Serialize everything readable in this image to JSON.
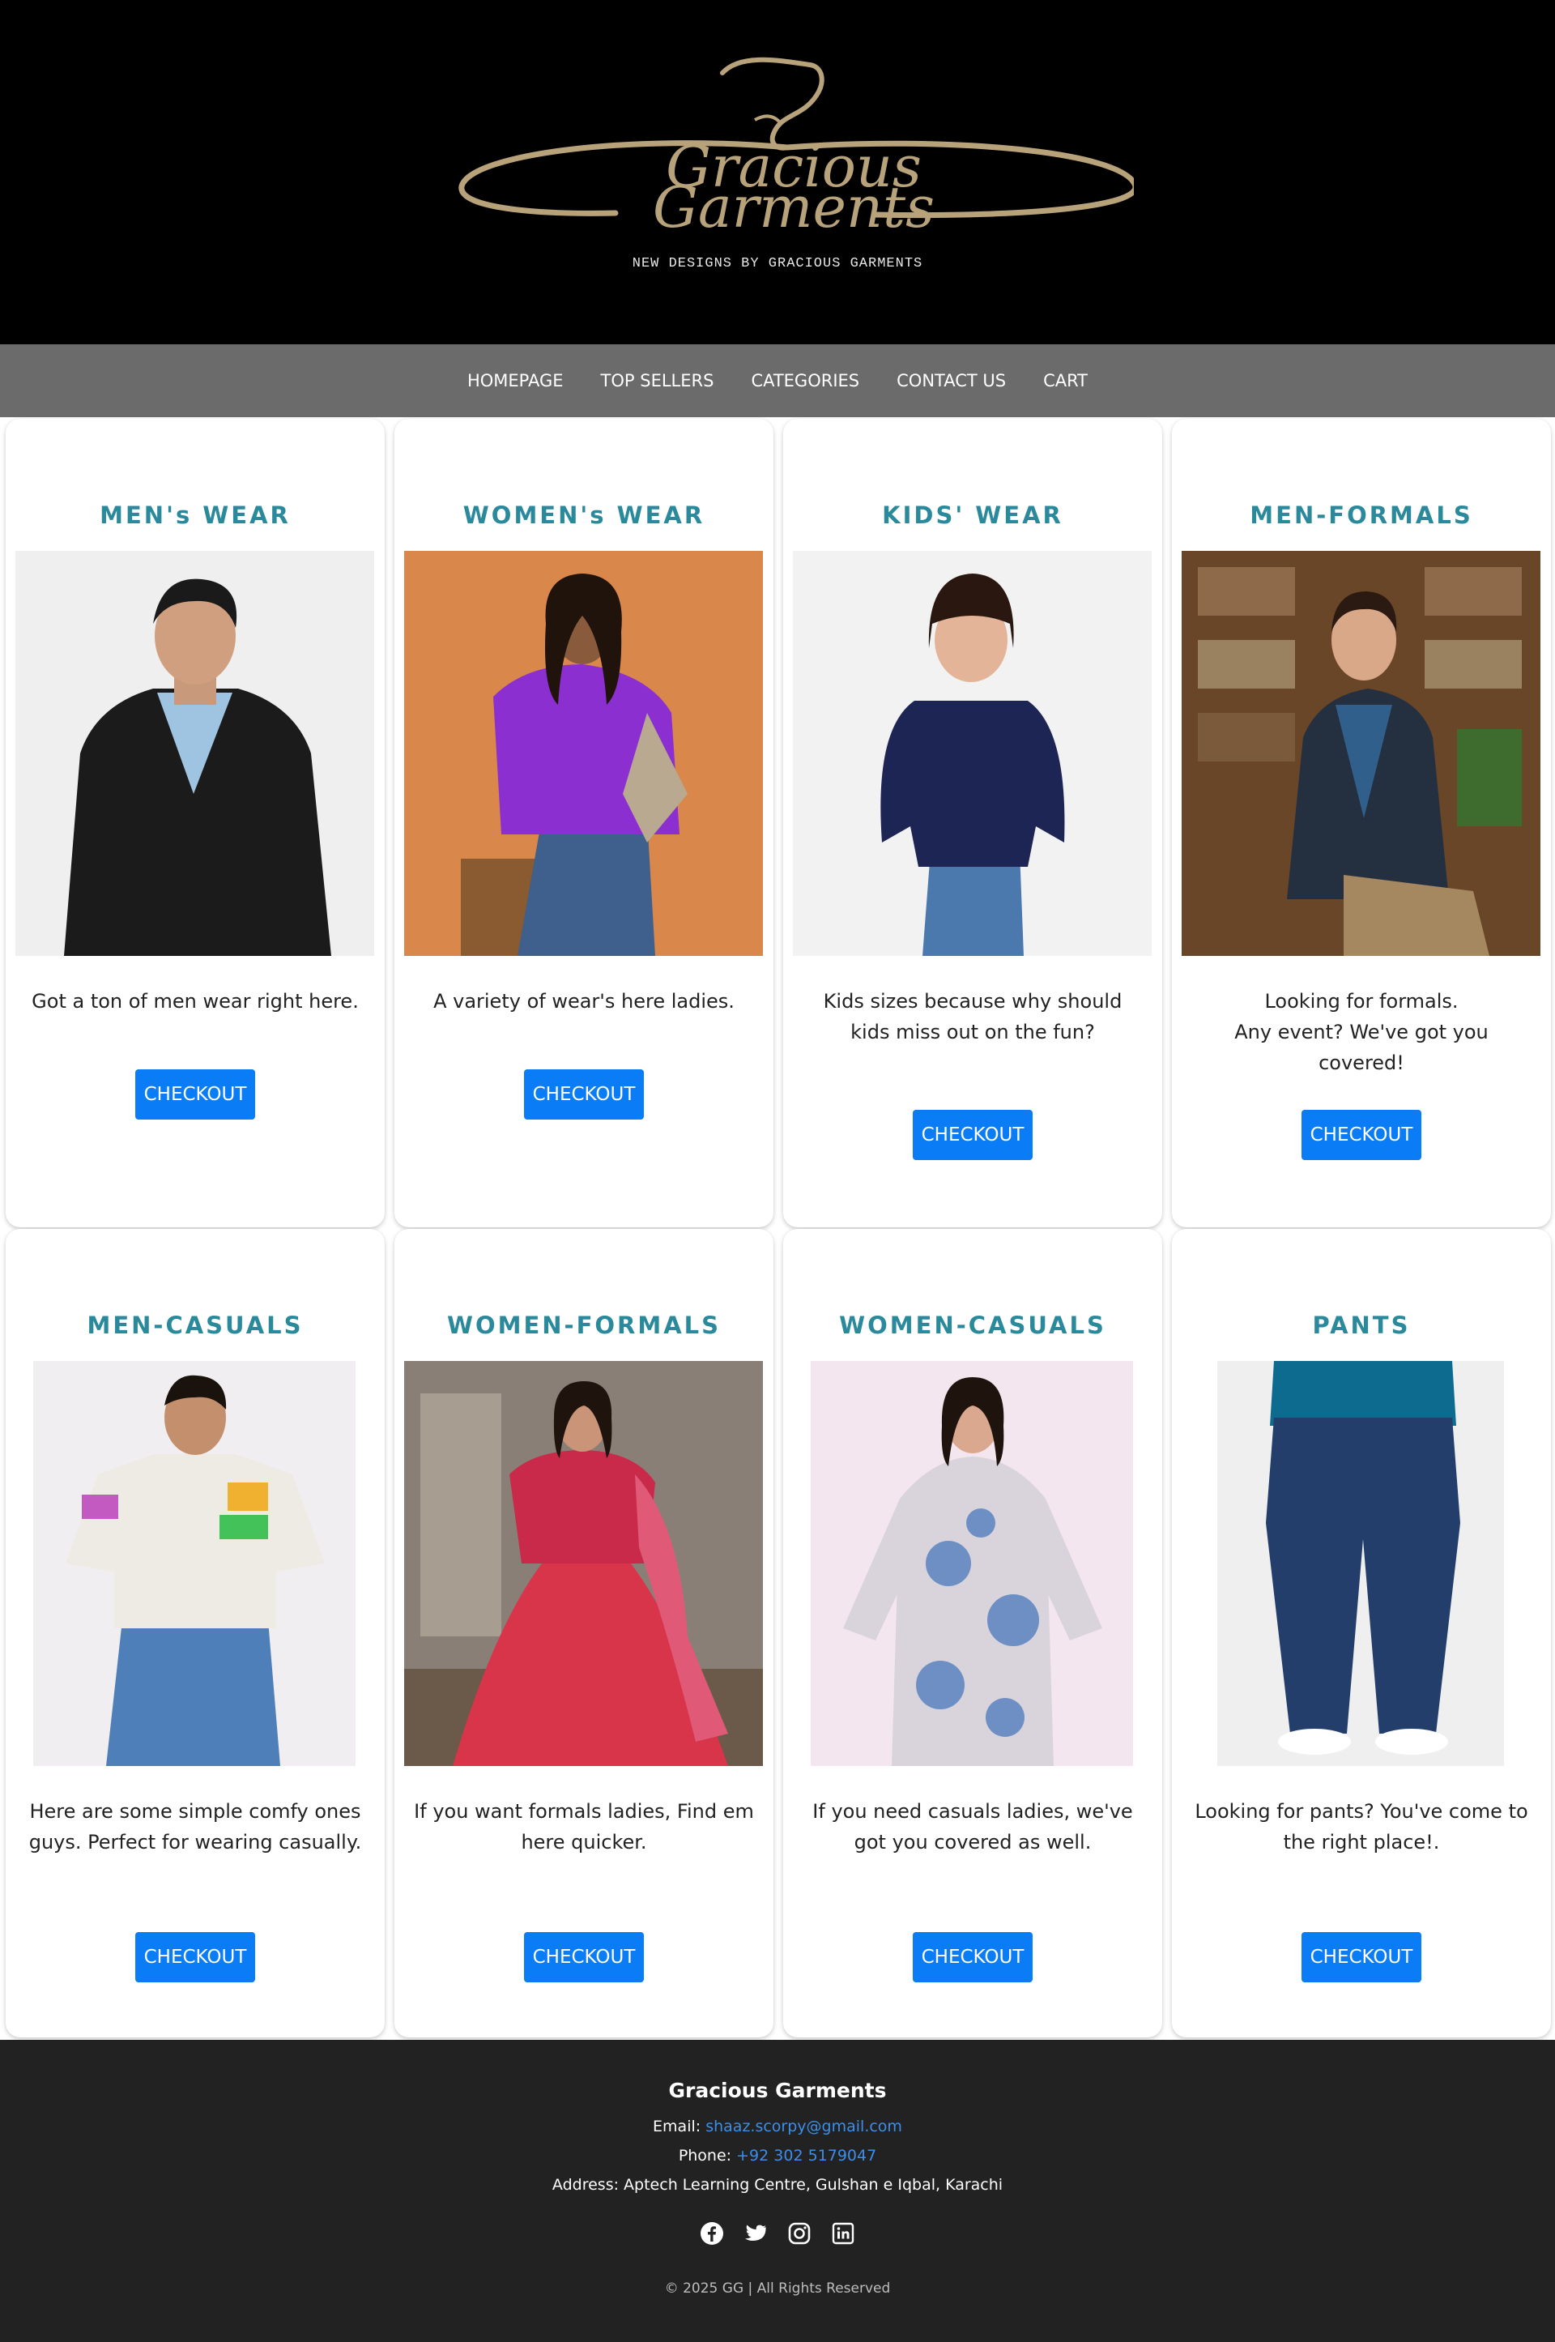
{
  "header": {
    "logo_line1": "Gracious",
    "logo_line2": "Garments",
    "tagline": "NEW DESIGNS BY GRACIOUS GARMENTS"
  },
  "nav": {
    "items": [
      {
        "label": "HOMEPAGE"
      },
      {
        "label": "TOP SELLERS"
      },
      {
        "label": "CATEGORIES"
      },
      {
        "label": "CONTACT US"
      },
      {
        "label": "CART"
      }
    ]
  },
  "cards": [
    {
      "title": "MEN's WEAR",
      "desc": "Got a ton of men wear right here.",
      "button": "CHECKOUT",
      "image": "man in black jacket and blue t-shirt"
    },
    {
      "title": "WOMEN's WEAR",
      "desc": "A variety of wear's here ladies.",
      "button": "CHECKOUT",
      "image": "woman in purple hoodie on stool"
    },
    {
      "title": "KIDS' WEAR",
      "desc": "Kids sizes because why should kids miss out on the fun?",
      "button": "CHECKOUT",
      "image": "child in navy sweater and jeans"
    },
    {
      "title": "MEN-FORMALS",
      "desc": "Looking for formals.\nAny event? We've got you covered!",
      "button": "CHECKOUT",
      "image": "man in blazer seated in library"
    },
    {
      "title": "MEN-CASUALS",
      "desc": "Here are some simple comfy ones guys. Perfect for wearing casually.",
      "button": "CHECKOUT",
      "image": "man in white graphic t-shirt and jeans"
    },
    {
      "title": "WOMEN-FORMALS",
      "desc": "If you want formals ladies, Find em here quicker.",
      "button": "CHECKOUT",
      "image": "woman in red embroidered lehenga"
    },
    {
      "title": "WOMEN-CASUALS",
      "desc": "If you need casuals ladies, we've got you covered as well.",
      "button": "CHECKOUT",
      "image": "woman in blue floral printed kurta"
    },
    {
      "title": "PANTS",
      "desc": "Looking for pants? You've come to the right place!.",
      "button": "CHECKOUT",
      "image": "person in dark blue jeans and white sneakers"
    }
  ],
  "footer": {
    "brand": "Gracious Garments",
    "email_label": "Email:",
    "email": "shaaz.scorpy@gmail.com",
    "phone_label": "Phone:",
    "phone": "+92 302 5179047",
    "address_label": "Address:",
    "address": "Aptech Learning Centre, Gulshan e Iqbal, Karachi",
    "socials": [
      "facebook-icon",
      "twitter-icon",
      "instagram-icon",
      "linkedin-icon"
    ],
    "copyright": "© 2025 GG | All Rights Reserved"
  },
  "colors": {
    "header_bg": "#000000",
    "nav_bg": "#6b6b6b",
    "title_color": "#2a8a9c",
    "button_bg": "#0a7cf5",
    "footer_bg": "#222222",
    "link_color": "#3b8eea",
    "logo_gold": "#b8a27a"
  }
}
